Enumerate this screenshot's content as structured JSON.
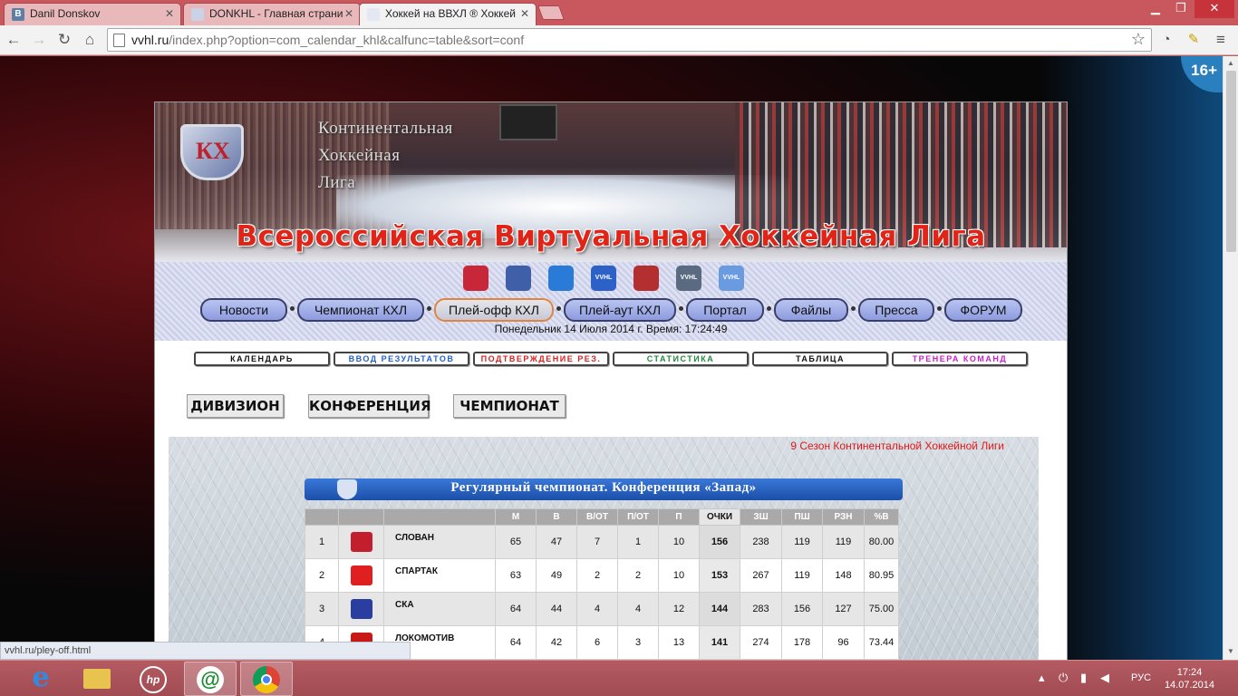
{
  "browser": {
    "tabs": [
      {
        "label": "Danil Donskov",
        "favicon_color": "#5b7fa6",
        "favicon_text": "В"
      },
      {
        "label": "DONKHL - Главная страни",
        "favicon_color": "#c9d2e6",
        "favicon_text": ""
      },
      {
        "label": "Хоккей на ВВХЛ ® Хоккей",
        "favicon_color": "#e4e8f2",
        "favicon_text": ""
      }
    ],
    "url_host": "vvhl.ru",
    "url_path": "/index.php?option=com_calendar_khl&calfunc=table&sort=conf",
    "status_url": "vvhl.ru/pley-off.html",
    "age_rating": "16+"
  },
  "site": {
    "khl_name_lines": [
      "Континентальная",
      "Хоккейная",
      "Лига"
    ],
    "banner_title": "Всероссийская Виртуальная Хоккейная Лига",
    "league_logo_colors": [
      "#c8273a",
      "#3f5fa8",
      "#2a7ad8",
      "#2c62c8",
      "#b43030",
      "#5a6a80",
      "#6a9ae0"
    ],
    "league_logo_labels": [
      "",
      "",
      "",
      "VVHL",
      "",
      "VVHL",
      "VVHL"
    ],
    "menu": [
      "Новости",
      "Чемпионат КХЛ",
      "Плей-офф КХЛ",
      "Плей-аут КХЛ",
      "Портал",
      "Файлы",
      "Пресса",
      "ФОРУМ"
    ],
    "menu_active": "Плей-офф КХЛ",
    "datetime": "Понедельник 14 Июля 2014 г. Время: 17:24:49",
    "subnav": [
      {
        "label": "КАЛЕНДАРЬ",
        "color": "#111111"
      },
      {
        "label": "ВВОД РЕЗУЛЬТАТОВ",
        "color": "#1f5fd0"
      },
      {
        "label": "ПОДТВЕРЖДЕНИЕ РЕЗ.",
        "color": "#d82020"
      },
      {
        "label": "СТАТИСТИКА",
        "color": "#1e8a3a"
      },
      {
        "label": "ТАБЛИЦА",
        "color": "#111111"
      },
      {
        "label": "ТРЕНЕРА КОМАНД",
        "color": "#c820c8"
      }
    ],
    "views": [
      "ДИВИЗИОН",
      "КОНФЕРЕНЦИЯ",
      "ЧЕМПИОНАТ"
    ],
    "season_note": "9 Сезон Континентальной Хоккейной Лиги"
  },
  "standings": {
    "title": "Регулярный чемпионат. Конференция «Запад»",
    "columns": [
      "",
      "",
      "",
      "М",
      "В",
      "В/ОТ",
      "П/ОТ",
      "П",
      "ОЧКИ",
      "ЗШ",
      "ПШ",
      "РЗН",
      "%В"
    ],
    "rows": [
      {
        "pos": "1",
        "team": "СЛОВАН",
        "logo_color": "#c21e2e",
        "m": "65",
        "w": "47",
        "wot": "7",
        "lot": "1",
        "l": "10",
        "pts": "156",
        "gf": "238",
        "ga": "119",
        "diff": "119",
        "pct": "80.00"
      },
      {
        "pos": "2",
        "team": "СПАРТАК",
        "logo_color": "#e02020",
        "m": "63",
        "w": "49",
        "wot": "2",
        "lot": "2",
        "l": "10",
        "pts": "153",
        "gf": "267",
        "ga": "119",
        "diff": "148",
        "pct": "80.95"
      },
      {
        "pos": "3",
        "team": "СКА",
        "logo_color": "#2a3ea0",
        "m": "64",
        "w": "44",
        "wot": "4",
        "lot": "4",
        "l": "12",
        "pts": "144",
        "gf": "283",
        "ga": "156",
        "diff": "127",
        "pct": "75.00"
      },
      {
        "pos": "4",
        "team": "ЛОКОМОТИВ",
        "logo_color": "#c81818",
        "m": "64",
        "w": "42",
        "wot": "6",
        "lot": "3",
        "l": "13",
        "pts": "141",
        "gf": "274",
        "ga": "178",
        "diff": "96",
        "pct": "73.44"
      }
    ]
  },
  "taskbar": {
    "lang": "РУС",
    "time": "17:24",
    "date": "14.07.2014"
  }
}
